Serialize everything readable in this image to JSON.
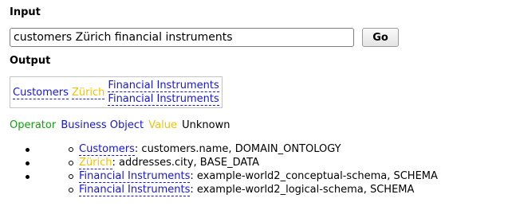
{
  "input": {
    "heading": "Input",
    "query_value": "customers Zürich financial instruments",
    "go_label": "Go"
  },
  "output": {
    "heading": "Output",
    "table": {
      "cells": [
        {
          "terms": [
            "Customers"
          ],
          "kind": "business-object"
        },
        {
          "terms": [
            "Zürich"
          ],
          "kind": "value"
        },
        {
          "terms": [
            "Financial Instruments",
            "Financial Instruments"
          ],
          "kind": "business-object"
        }
      ]
    },
    "legend": {
      "operator": "Operator",
      "business_object": "Business Object",
      "value": "Value",
      "unknown": "Unknown"
    },
    "results": [
      {
        "term": "Customers",
        "kind": "business-object",
        "detail": ": customers.name, DOMAIN_ONTOLOGY"
      },
      {
        "term": "Zürich",
        "kind": "value",
        "detail": ": addresses.city, BASE_DATA"
      },
      {
        "term": "Financial Instruments",
        "kind": "business-object",
        "detail": ": example-world2_conceptual-schema, SCHEMA"
      },
      {
        "term": "Financial Instruments",
        "kind": "business-object",
        "detail": ": example-world2_logical-schema, SCHEMA"
      }
    ]
  },
  "colors": {
    "operator": "#10a010",
    "business_object": "#1515e0",
    "value": "#f2c200",
    "unknown": "#000000",
    "underline": "#2626e6"
  }
}
